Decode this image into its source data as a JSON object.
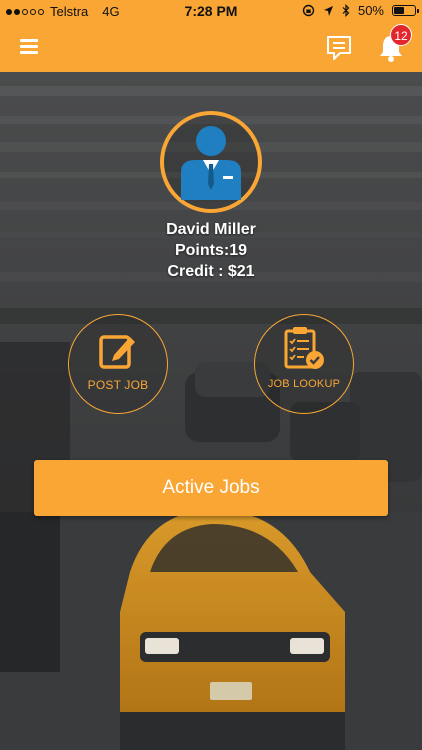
{
  "status_bar": {
    "carrier": "Telstra",
    "network": "4G",
    "time": "7:28 PM",
    "battery": "50%",
    "battery_level": 0.5
  },
  "nav": {
    "menu_icon": "hamburger-menu-icon",
    "chat_icon": "chat-bubble-icon",
    "bell_icon": "bell-icon",
    "notification_count": "12"
  },
  "profile": {
    "name": "David Miller",
    "points": "Points:19",
    "credit": "Credit : $21",
    "avatar_icon": "person-avatar-icon"
  },
  "actions": {
    "post_job": {
      "label": "POST JOB",
      "icon": "edit-note-icon"
    },
    "job_lookup": {
      "label": "JOB LOOKUP",
      "icon": "clipboard-check-icon"
    }
  },
  "active_jobs_label": "Active Jobs",
  "colors": {
    "accent": "#f9a635",
    "badge": "#e3262b",
    "avatar": "#1f7fc0"
  }
}
